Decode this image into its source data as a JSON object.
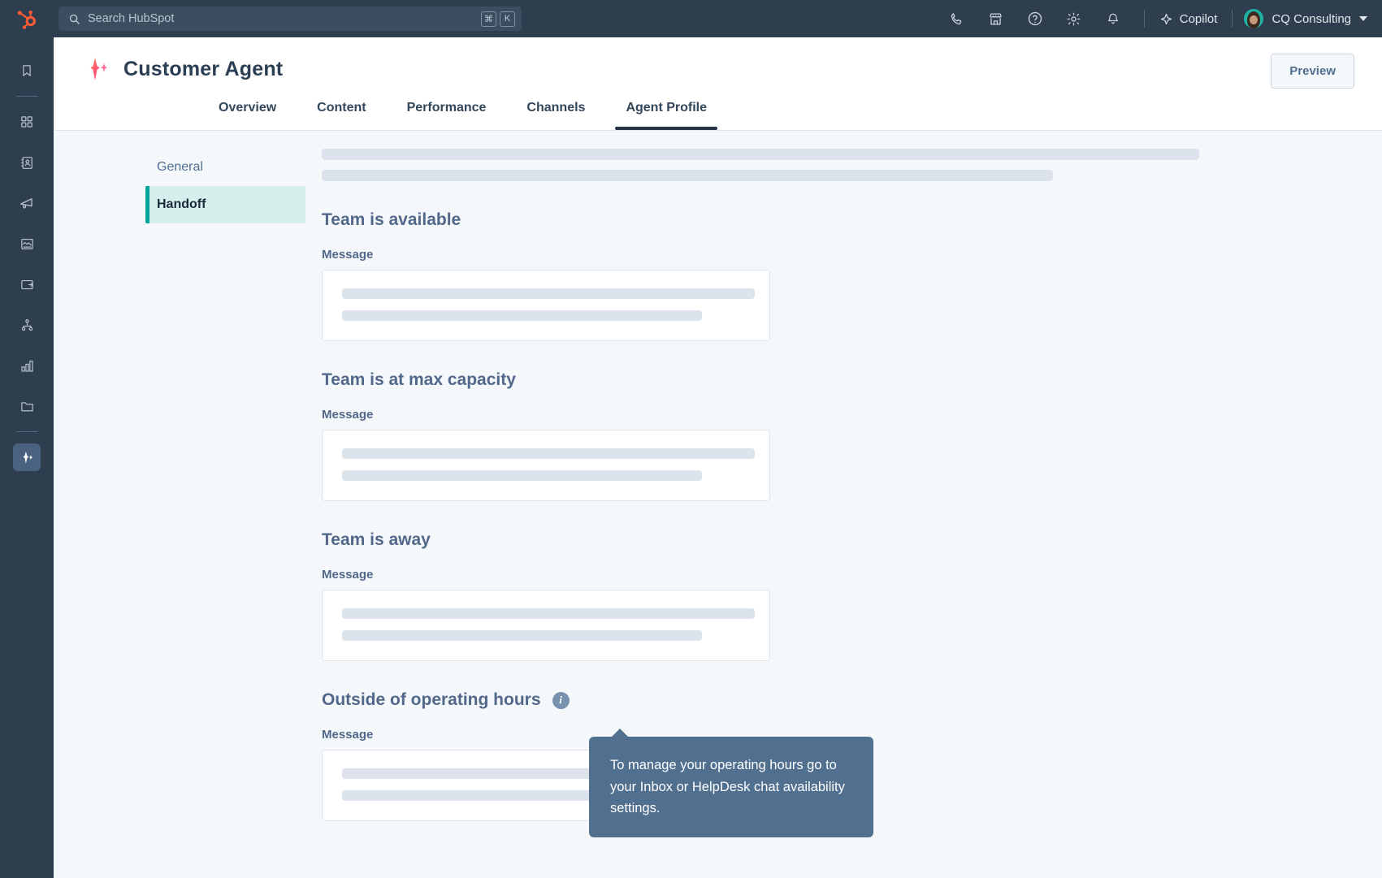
{
  "topbar": {
    "logo_icon": "hubspot-sprocket-logo",
    "search": {
      "placeholder": "Search HubSpot",
      "icon": "search-icon",
      "shortcut_keys": [
        "⌘",
        "K"
      ]
    },
    "icons": [
      {
        "name": "calling-icon",
        "label": "Calling"
      },
      {
        "name": "marketplace-icon",
        "label": "Marketplace"
      },
      {
        "name": "help-icon",
        "label": "Help"
      },
      {
        "name": "settings-gear-icon",
        "label": "Settings"
      },
      {
        "name": "notifications-bell-icon",
        "label": "Notifications"
      }
    ],
    "copilot": {
      "label": "Copilot",
      "icon": "sparkle-icon"
    },
    "account": {
      "label": "CQ Consulting",
      "avatar_icon": "user-avatar",
      "chevron_icon": "chevron-down-icon"
    }
  },
  "rail": {
    "items": [
      {
        "name": "bookmark-icon",
        "label": "Bookmarks"
      },
      {
        "name": "workspaces-grid-icon",
        "label": "Workspaces"
      },
      {
        "name": "contacts-icon",
        "label": "CRM"
      },
      {
        "name": "marketing-megaphone-icon",
        "label": "Marketing"
      },
      {
        "name": "content-icon",
        "label": "Content"
      },
      {
        "name": "commerce-icon",
        "label": "Commerce"
      },
      {
        "name": "automation-icon",
        "label": "Automation"
      },
      {
        "name": "reporting-bar-chart-icon",
        "label": "Reporting"
      },
      {
        "name": "library-folder-icon",
        "label": "Library"
      },
      {
        "name": "ai-sparkle-icon",
        "label": "AI Agents"
      }
    ]
  },
  "page": {
    "title": "Customer Agent",
    "title_icon": "ai-sparkle-icon",
    "preview_label": "Preview",
    "tabs": [
      {
        "label": "Overview",
        "active": false
      },
      {
        "label": "Content",
        "active": false
      },
      {
        "label": "Performance",
        "active": false
      },
      {
        "label": "Channels",
        "active": false
      },
      {
        "label": "Agent Profile",
        "active": true
      }
    ]
  },
  "subnav": {
    "items": [
      {
        "label": "General",
        "active": false
      },
      {
        "label": "Handoff",
        "active": true
      }
    ]
  },
  "panel": {
    "sections": [
      {
        "title": "Team is available",
        "field_label": "Message",
        "has_info": false
      },
      {
        "title": "Team is at max capacity",
        "field_label": "Message",
        "has_info": false
      },
      {
        "title": "Team is away",
        "field_label": "Message",
        "has_info": false
      },
      {
        "title": "Outside of operating hours",
        "field_label": "Message",
        "has_info": true,
        "info_icon": "info-icon"
      }
    ]
  },
  "tooltip": {
    "text": "To manage your operating hours go to your Inbox or HelpDesk chat availability settings."
  },
  "colors": {
    "navy": "#2e3e4e",
    "teal_accent": "#00a39b",
    "teal_bg": "#d4efec",
    "slate_text": "#51688a",
    "tooltip_bg": "#51708f",
    "skeleton": "#dde3ec",
    "page_bg": "#f5f8fa",
    "sparkle_orange": "#ff5c35"
  }
}
